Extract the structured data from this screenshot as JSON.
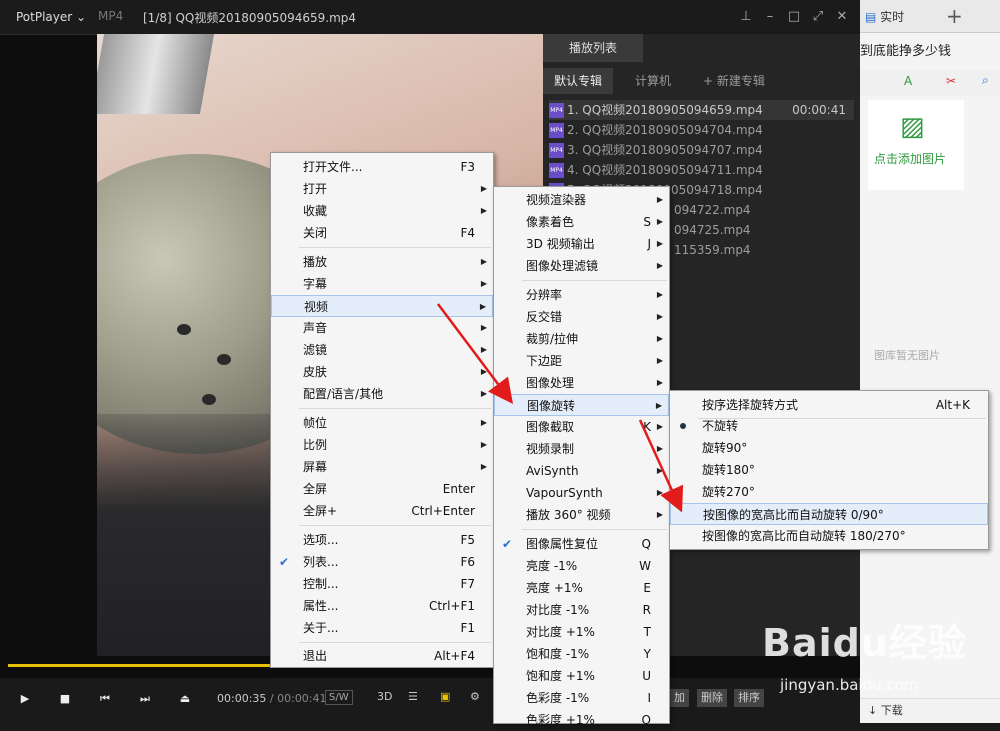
{
  "window": {
    "app_label": "PotPlayer",
    "format": "MP4",
    "title": "[1/8] QQ视频20180905094659.mp4"
  },
  "playlist": {
    "header": "播放列表",
    "tabs": [
      "默认专辑",
      "计算机",
      "+ 新建专辑"
    ],
    "items": [
      {
        "name": "1. QQ视频20180905094659.mp4",
        "duration": "00:00:41"
      },
      {
        "name": "2. QQ视频20180905094704.mp4"
      },
      {
        "name": "3. QQ视频20180905094707.mp4"
      },
      {
        "name": "4. QQ视频20180905094711.mp4"
      },
      {
        "name": "5. QQ视频20180905094718.mp4"
      },
      {
        "name": "094722.mp4"
      },
      {
        "name": "094725.mp4"
      },
      {
        "name": "115359.mp4"
      }
    ],
    "bottom_buttons": [
      "加",
      "删除",
      "排序"
    ]
  },
  "controls": {
    "time_current": "00:00:35",
    "time_sep": " / ",
    "time_total": "00:00:41",
    "sw": "S/W",
    "three_d": "3D"
  },
  "menu1": {
    "items": [
      {
        "label": "打开文件...",
        "key": "F3"
      },
      {
        "label": "打开",
        "arrow": true
      },
      {
        "label": "收藏",
        "arrow": true
      },
      {
        "label": "关闭",
        "key": "F4"
      },
      {
        "label": "播放",
        "arrow": true
      },
      {
        "label": "字幕",
        "arrow": true
      },
      {
        "label": "视频",
        "arrow": true
      },
      {
        "label": "声音",
        "arrow": true
      },
      {
        "label": "滤镜",
        "arrow": true
      },
      {
        "label": "皮肤",
        "arrow": true
      },
      {
        "label": "配置/语言/其他",
        "arrow": true
      },
      {
        "label": "帧位",
        "arrow": true
      },
      {
        "label": "比例",
        "arrow": true
      },
      {
        "label": "屏幕",
        "arrow": true
      },
      {
        "label": "全屏",
        "key": "Enter"
      },
      {
        "label": "全屏+",
        "key": "Ctrl+Enter"
      },
      {
        "label": "选项...",
        "key": "F5"
      },
      {
        "label": "列表...",
        "key": "F6"
      },
      {
        "label": "控制...",
        "key": "F7"
      },
      {
        "label": "属性...",
        "key": "Ctrl+F1"
      },
      {
        "label": "关于...",
        "key": "F1"
      },
      {
        "label": "退出",
        "key": "Alt+F4"
      }
    ]
  },
  "menu2": {
    "items": [
      {
        "label": "视频渲染器",
        "arrow": true
      },
      {
        "label": "像素着色",
        "key": "S"
      },
      {
        "label": "3D 视频输出",
        "key": "J"
      },
      {
        "label": "图像处理滤镜",
        "arrow": true
      },
      {
        "label": "分辨率",
        "arrow": true
      },
      {
        "label": "反交错",
        "arrow": true
      },
      {
        "label": "裁剪/拉伸",
        "arrow": true
      },
      {
        "label": "下边距",
        "arrow": true
      },
      {
        "label": "图像处理",
        "arrow": true
      },
      {
        "label": "图像旋转",
        "arrow": true
      },
      {
        "label": "图像截取",
        "key": "K"
      },
      {
        "label": "视频录制",
        "arrow": true
      },
      {
        "label": "AviSynth",
        "arrow": true
      },
      {
        "label": "VapourSynth",
        "arrow": true
      },
      {
        "label": "播放 360° 视频",
        "arrow": true
      },
      {
        "label": "图像属性复位",
        "key": "Q"
      },
      {
        "label": "亮度 -1%",
        "key": "W"
      },
      {
        "label": "亮度 +1%",
        "key": "E"
      },
      {
        "label": "对比度 -1%",
        "key": "R"
      },
      {
        "label": "对比度 +1%",
        "key": "T"
      },
      {
        "label": "饱和度 -1%",
        "key": "Y"
      },
      {
        "label": "饱和度 +1%",
        "key": "U"
      },
      {
        "label": "色彩度 -1%",
        "key": "I"
      },
      {
        "label": "色彩度 +1%",
        "key": "O"
      }
    ]
  },
  "menu3": {
    "items": [
      {
        "label": "按序选择旋转方式",
        "key": "Alt+K"
      },
      {
        "label": "不旋转"
      },
      {
        "label": "旋转90°"
      },
      {
        "label": "旋转180°"
      },
      {
        "label": "旋转270°"
      },
      {
        "label": "按图像的宽高比而自动旋转 0/90°"
      },
      {
        "label": "按图像的宽高比而自动旋转 180/270°"
      }
    ]
  },
  "right_app": {
    "tab_label": "实时",
    "headline": "到底能挣多少钱",
    "add_image": "点击添加图片",
    "empty_text": "图库暂无图片",
    "download": "下载"
  },
  "watermark": {
    "logo": "Baidu经验",
    "url": "jingyan.baidu.com"
  },
  "colors": {
    "seek_bar": "#e8c200",
    "menu_highlight": "#e4eefb",
    "arrow_red": "#e21b1b",
    "mp4_icon": "#6b4ec7"
  }
}
